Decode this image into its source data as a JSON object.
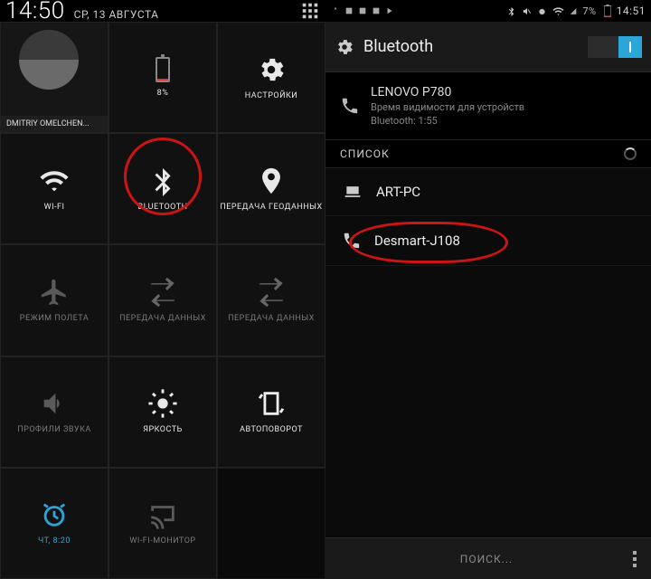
{
  "left": {
    "statusbar": {
      "time": "14:50"
    },
    "header": {
      "clock": "14:50",
      "date": "СР, 13 АВГУСТА"
    },
    "user": {
      "name": "DMITRIY OMELCHEN..."
    },
    "tiles": {
      "battery": {
        "pct": "8%"
      },
      "settings": {
        "label": "НАСТРОЙКИ"
      },
      "wifi": {
        "label": "WI-FI"
      },
      "bluetooth": {
        "label": "BLUETOOTH"
      },
      "location": {
        "label": "ПЕРЕДАЧА ГЕОДАННЫХ"
      },
      "airplane": {
        "label": "РЕЖИМ ПОЛЕТА"
      },
      "data1": {
        "label": "ПЕРЕДАЧА ДАННЫХ"
      },
      "data2": {
        "label": "ПЕРЕДАЧА ДАННЫХ"
      },
      "sound": {
        "label": "ПРОФИЛИ ЗВУКА"
      },
      "brightness": {
        "label": "ЯРКОСТЬ"
      },
      "autorotate": {
        "label": "АВТОПОВОРОТ"
      },
      "alarm": {
        "label": "ЧТ, 8:20"
      },
      "cast": {
        "label": "WI-FI-МОНИТОР"
      }
    }
  },
  "right": {
    "statusbar": {
      "battery_pct": "7%",
      "time": "14:51"
    },
    "actionbar": {
      "title": "Bluetooth"
    },
    "self_device": {
      "name": "LENOVO P780",
      "hint_line1": "Время видимости для устройств",
      "hint_line2": "Bluetooth: 1:55"
    },
    "list_header": "СПИСОК",
    "devices": [
      {
        "name": "ART-PC",
        "icon": "laptop"
      },
      {
        "name": "Desmart-J108",
        "icon": "phone"
      }
    ],
    "bottombar": {
      "search": "ПОИСК..."
    }
  }
}
